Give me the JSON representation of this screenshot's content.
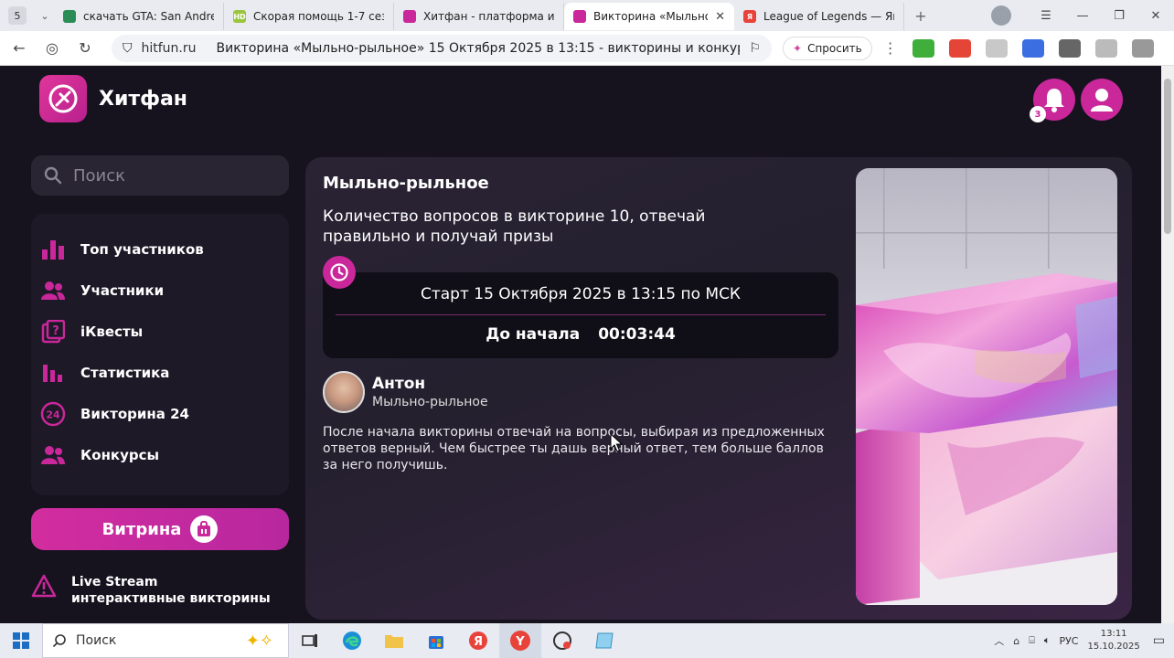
{
  "browser": {
    "tab_count": "5",
    "tabs": [
      {
        "title": "скачать GTA: San Andreas",
        "favicon_color": "#2c8c57"
      },
      {
        "title": "Скорая помощь 1-7 сезон",
        "favicon_color": "#9bc53d",
        "favicon_text": "HD"
      },
      {
        "title": "Хитфан - платформа инте",
        "favicon_color": "#c9279a"
      },
      {
        "title": "Викторина «Мыльно-р",
        "favicon_color": "#c9279a",
        "active": true
      },
      {
        "title": "League of Legends — Янд",
        "favicon_color": "#e8433a",
        "favicon_text": "Я"
      }
    ],
    "url_host": "hitfun.ru",
    "page_title": "Викторина «Мыльно-рыльное» 15 Октября 2025 в 13:15 - викторины и конкур...",
    "ask_label": "Спросить",
    "accent": "#c9279a"
  },
  "header": {
    "logo_text": "Хитфан",
    "notifications_count": "3"
  },
  "sidebar": {
    "search_placeholder": "Поиск",
    "items": [
      {
        "label": "Топ участников",
        "icon": "bar-chart-icon"
      },
      {
        "label": "Участники",
        "icon": "users-icon"
      },
      {
        "label": "iКвесты",
        "icon": "quest-icon"
      },
      {
        "label": "Статистика",
        "icon": "stats-icon"
      },
      {
        "label": "Викторина 24",
        "icon": "quiz24-icon"
      },
      {
        "label": "Конкурсы",
        "icon": "contest-icon"
      }
    ],
    "vitrina_label": "Витрина",
    "live_line1": "Live Stream",
    "live_line2": "интерактивные викторины"
  },
  "quiz": {
    "title": "Мыльно-рыльное",
    "description": "Количество вопросов в викторине 10, отвечай правильно и получай призы",
    "start_text": "Старт 15 Октября 2025 в 13:15 по МСК",
    "countdown_label": "До начала",
    "countdown_value": "00:03:44",
    "author_name": "Антон",
    "author_subtitle": "Мыльно-рыльное",
    "rules": "После начала викторины отвечай на вопросы, выбирая из предложенных ответов верный. Чем быстрее ты дашь верный ответ, тем больше баллов за него получишь."
  },
  "taskbar": {
    "search_label": "Поиск",
    "lang": "РУС",
    "time": "13:11",
    "date": "15.10.2025"
  }
}
